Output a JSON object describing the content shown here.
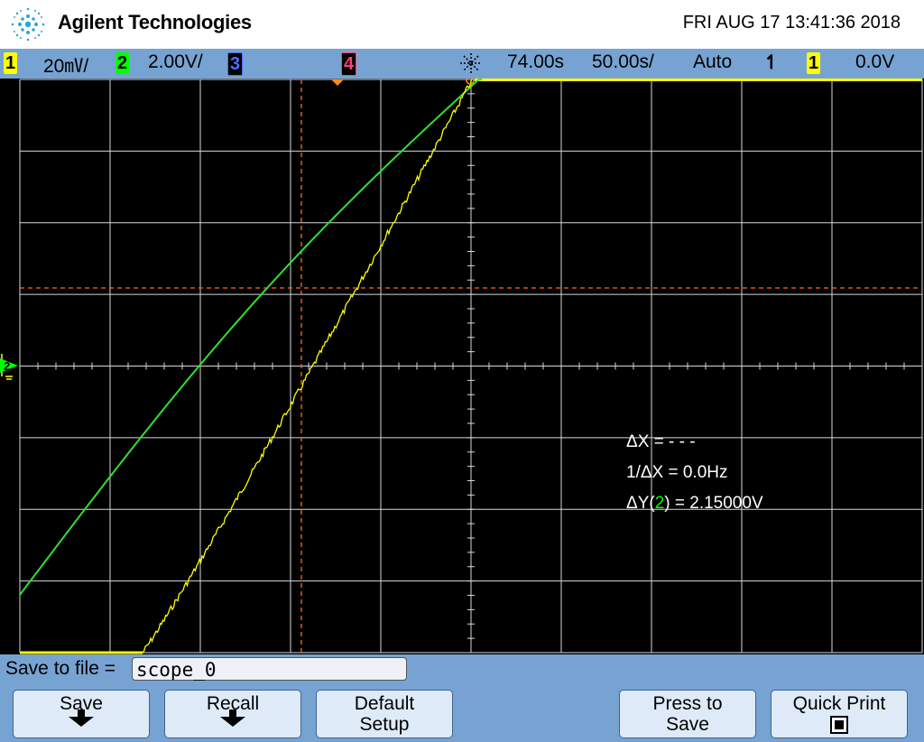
{
  "header": {
    "brand": "Agilent Technologies",
    "datetime": "FRI AUG 17 13:41:36 2018"
  },
  "status_bar": {
    "ch1_num": "1",
    "ch1_scale": "20㎷/",
    "ch2_num": "2",
    "ch2_scale": "2.00V/",
    "ch3_num": "3",
    "ch4_num": "4",
    "time_delay": "74.00s",
    "time_scale": "50.00s/",
    "trigger_mode": "Auto",
    "trigger_slope": "↿",
    "trigger_source": "1",
    "trigger_level": "0.0V"
  },
  "colors": {
    "ch1": "#ffff00",
    "ch2": "#00ff00",
    "ch3": "#4a6cff",
    "ch4": "#ff3e7a",
    "cursor": "#ff6a1a",
    "grid": "#d8d8d8",
    "panel": "#77a3d3"
  },
  "measurements": {
    "delta_x": "ΔX = - - -",
    "inv_delta_x": "1/ΔX = 0.0Hz",
    "delta_y_prefix": "ΔY(",
    "delta_y_channel": "2",
    "delta_y_suffix": ") = 2.15000V"
  },
  "ground_marker": "2",
  "save": {
    "label": "Save to file =",
    "filename": "scope_0"
  },
  "softkeys": {
    "save": "Save",
    "recall": "Recall",
    "default_line1": "Default",
    "default_line2": "Setup",
    "press_line1": "Press to",
    "press_line2": "Save",
    "quick_print": "Quick Print"
  }
}
